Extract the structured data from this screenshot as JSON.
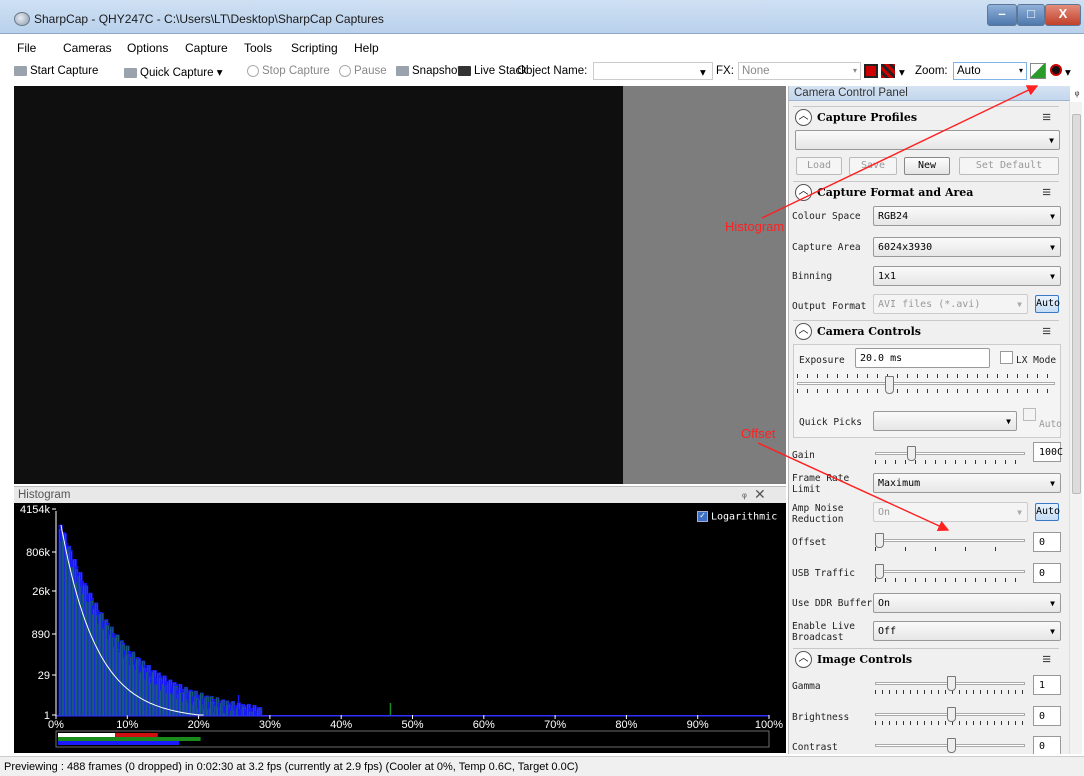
{
  "window": {
    "title": "SharpCap - QHY247C - C:\\Users\\LT\\Desktop\\SharpCap Captures",
    "minimize": "–",
    "maximize": "□",
    "close": "X"
  },
  "menu": {
    "items": [
      {
        "label": "File"
      },
      {
        "label": "Cameras"
      },
      {
        "label": "Options"
      },
      {
        "label": "Capture"
      },
      {
        "label": "Tools"
      },
      {
        "label": "Scripting"
      },
      {
        "label": "Help"
      }
    ]
  },
  "toolbar": {
    "start_capture": "Start Capture",
    "quick_capture": "Quick Capture",
    "stop_capture": "Stop Capture",
    "pause": "Pause",
    "snapshot": "Snapshot",
    "live_stack": "Live Stack",
    "object_name_label": "Object Name:",
    "fx_label": "FX:",
    "fx_value": "None",
    "zoom_label": "Zoom:",
    "zoom_value": "Auto",
    "dropdown_arrow": "▾"
  },
  "histogram": {
    "title": "Histogram",
    "pin": "ᵩ",
    "close": "✕",
    "logarithmic_label": "Logarithmic",
    "y_ticks": [
      "4154k",
      "806k",
      "26k",
      "890",
      "29",
      "1"
    ],
    "x_ticks": [
      "0%",
      "10%",
      "20%",
      "30%",
      "40%",
      "50%",
      "60%",
      "70%",
      "80%",
      "90%",
      "100%"
    ],
    "colors": {
      "blue": "#1a1aff",
      "green": "#1a8a1a",
      "red": "#d01010",
      "white": "#ffffff"
    }
  },
  "control_panel": {
    "title": "Camera Control Panel",
    "pin": "ᵩ",
    "capture_profiles": {
      "title": "Capture Profiles",
      "profile_value": "",
      "load": "Load",
      "save": "Save",
      "new": "New",
      "set_default": "Set Default"
    },
    "capture_format": {
      "title": "Capture Format and Area",
      "colour_space_label": "Colour Space",
      "colour_space_value": "RGB24",
      "capture_area_label": "Capture Area",
      "capture_area_value": "6024x3930",
      "binning_label": "Binning",
      "binning_value": "1x1",
      "output_format_label": "Output Format",
      "output_format_value": "AVI files (*.avi)",
      "auto": "Auto"
    },
    "camera_controls": {
      "title": "Camera Controls",
      "exposure_label": "Exposure",
      "exposure_value": "20.0 ms",
      "lx_mode": "LX Mode",
      "quick_picks_label": "Quick Picks",
      "quick_picks_auto": "Auto",
      "gain_label": "Gain",
      "gain_value": "100C",
      "frame_rate_label": "Frame Rate Limit",
      "frame_rate_value": "Maximum",
      "amp_noise_label": "Amp Noise Reduction",
      "amp_noise_value": "On",
      "amp_noise_auto": "Auto",
      "offset_label": "Offset",
      "offset_value": "0",
      "usb_traffic_label": "USB Traffic",
      "usb_traffic_value": "0",
      "ddr_buffer_label": "Use DDR Buffer",
      "ddr_buffer_value": "On",
      "live_broadcast_label": "Enable Live Broadcast",
      "live_broadcast_value": "Off"
    },
    "image_controls": {
      "title": "Image Controls",
      "gamma_label": "Gamma",
      "gamma_value": "1",
      "brightness_label": "Brightness",
      "brightness_value": "0",
      "contrast_label": "Contrast",
      "contrast_value": "0"
    }
  },
  "annotations": {
    "histogram": "Histogram",
    "offset": "Offset",
    "color": "#ff2020"
  },
  "status": {
    "text": "Previewing : 488 frames (0 dropped) in 0:02:30 at 3.2 fps  (currently at 2.9 fps) (Cooler at 0%, Temp 0.6C, Target 0.0C)"
  }
}
